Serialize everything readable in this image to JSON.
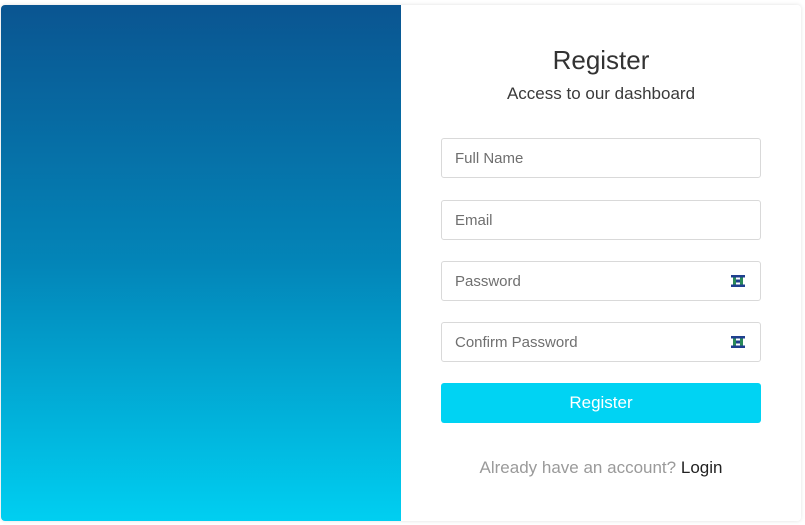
{
  "header": {
    "title": "Register",
    "subtitle": "Access to our dashboard"
  },
  "form": {
    "full_name_placeholder": "Full Name",
    "email_placeholder": "Email",
    "password_placeholder": "Password",
    "confirm_password_placeholder": "Confirm Password",
    "register_label": "Register"
  },
  "footer": {
    "prompt": "Already have an account?",
    "login_label": "Login"
  },
  "icons": {
    "password_toggle": "eye-icon"
  },
  "colors": {
    "accent": "#00d3f3",
    "gradient_top": "#0a5591",
    "gradient_bottom": "#00cff1"
  }
}
